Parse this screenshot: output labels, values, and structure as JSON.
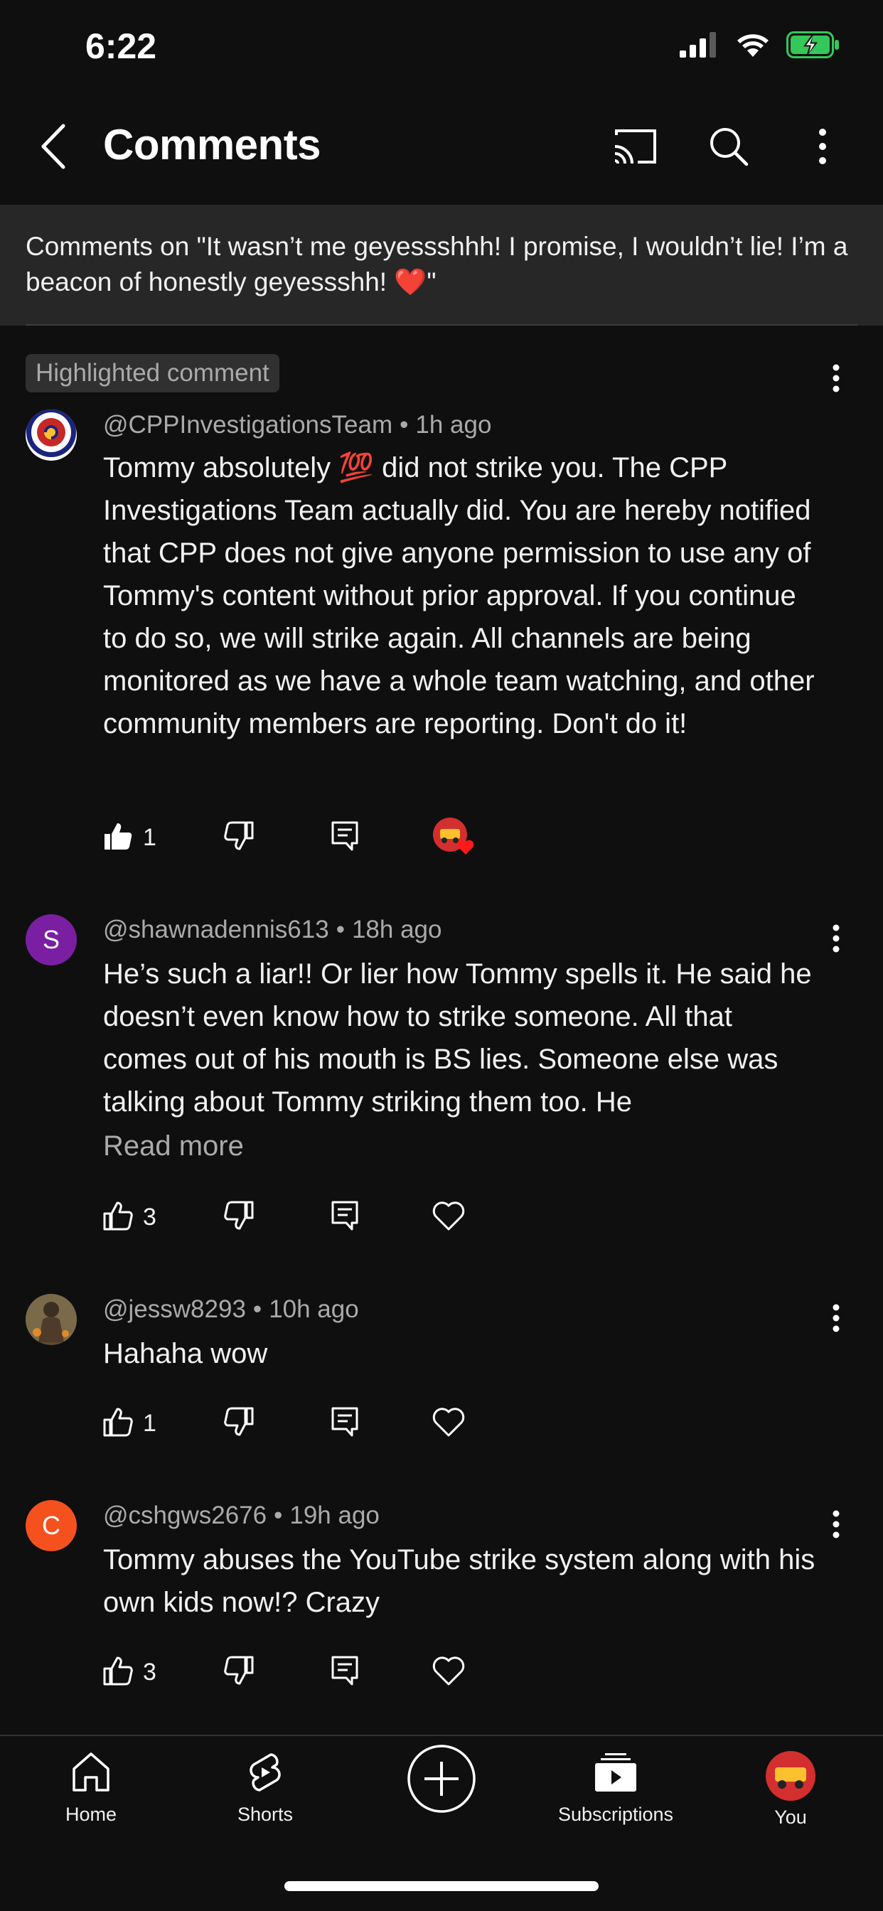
{
  "status_bar": {
    "time": "6:22"
  },
  "header": {
    "title": "Comments"
  },
  "context": {
    "text": "Comments on \"It wasn’t me geyessshhh! I promise, I wouldn’t lie! I’m a beacon of honestly geyessshh! ❤️\""
  },
  "comments": [
    {
      "highlight_label": "Highlighted comment",
      "author": "@CPPInvestigationsTeam",
      "time": "1h ago",
      "text": "Tommy absolutely 💯 did not strike you.  The CPP Investigations Team actually did. You are hereby notified that CPP does not give anyone permission to use any of Tommy's content without prior approval. If you continue to do so, we will strike again. All channels are being monitored as we have a whole team watching, and other community members are reporting. Don't do it!",
      "likes": "1",
      "creator_hearted": true
    },
    {
      "author": "@shawnadennis613",
      "time": "18h ago",
      "avatar_letter": "S",
      "avatar_color": "#7b1fa2",
      "text": "He’s such a liar!! Or lier how Tommy spells it. He said he doesn’t even know how to strike someone. All that comes out of his mouth is BS lies. Someone else was talking about Tommy striking them too. He",
      "read_more": "Read more",
      "likes": "3"
    },
    {
      "author": "@jessw8293",
      "time": "10h ago",
      "text": "Hahaha wow",
      "likes": "1"
    },
    {
      "author": "@cshgws2676",
      "time": "19h ago",
      "avatar_letter": "C",
      "avatar_color": "#f4511e",
      "text": "Tommy abuses the YouTube strike system along with his own kids now!? Crazy",
      "likes": "3"
    }
  ],
  "bottom_nav": {
    "home": "Home",
    "shorts": "Shorts",
    "subscriptions": "Subscriptions",
    "you": "You"
  },
  "icons": {
    "back": "chevron-left-icon",
    "cast": "cast-icon",
    "search": "search-icon",
    "more": "more-vert-icon",
    "like": "thumb-up-icon",
    "dislike": "thumb-down-icon",
    "reply": "reply-icon",
    "heart": "heart-icon"
  }
}
